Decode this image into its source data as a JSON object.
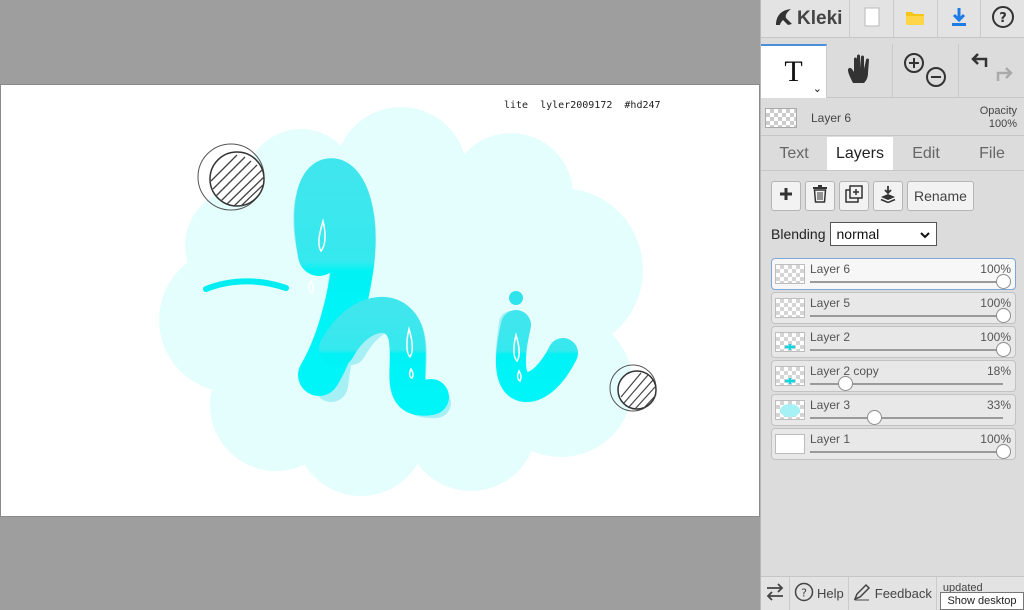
{
  "canvas": {
    "caption": "lite  lyler2009172  #hd247",
    "colors": {
      "cloud": "#e4fdfd",
      "letter_top": "#3fe6ed",
      "letter_bottom": "#00f3f6",
      "shadow": "#a6f0f5"
    }
  },
  "topbar": {
    "logo_text": "Kleki",
    "icons": [
      "kleki-logo-icon",
      "new-file-icon",
      "open-folder-icon",
      "download-icon",
      "help-icon"
    ],
    "help_glyph": "?"
  },
  "tools": {
    "text_tool_glyph": "T",
    "caret_glyph": "⌄",
    "icons": [
      "text-tool-icon",
      "hand-tool-icon",
      "zoom-icon",
      "undo-redo-icon"
    ]
  },
  "layer_info": {
    "name": "Layer 6",
    "opacity_label": "Opacity",
    "opacity_value": "100%"
  },
  "tabs": [
    {
      "label": "Text"
    },
    {
      "label": "Layers"
    },
    {
      "label": "Edit"
    },
    {
      "label": "File"
    }
  ],
  "active_tab": "Layers",
  "panel": {
    "rename_label": "Rename",
    "action_icons": [
      "add-layer-icon",
      "delete-layer-icon",
      "duplicate-layer-icon",
      "merge-down-icon"
    ],
    "blending_label": "Blending",
    "blending_value": "normal"
  },
  "layers": [
    {
      "name": "Layer 6",
      "opacity_label": "100%",
      "opacity": 1.0,
      "selected": true,
      "thumb": "transparent"
    },
    {
      "name": "Layer 5",
      "opacity_label": "100%",
      "opacity": 1.0,
      "selected": false,
      "thumb": "transparent"
    },
    {
      "name": "Layer 2",
      "opacity_label": "100%",
      "opacity": 1.0,
      "selected": false,
      "thumb": "cyan-mark"
    },
    {
      "name": "Layer 2 copy",
      "opacity_label": "18%",
      "opacity": 0.18,
      "selected": false,
      "thumb": "cyan-mark"
    },
    {
      "name": "Layer 3",
      "opacity_label": "33%",
      "opacity": 0.33,
      "selected": false,
      "thumb": "blob"
    },
    {
      "name": "Layer 1",
      "opacity_label": "100%",
      "opacity": 1.0,
      "selected": false,
      "thumb": "white"
    }
  ],
  "bottombar": {
    "help_label": "Help",
    "feedback_label": "Feedback",
    "updated_label": "updated",
    "tooltip": "Show desktop"
  }
}
